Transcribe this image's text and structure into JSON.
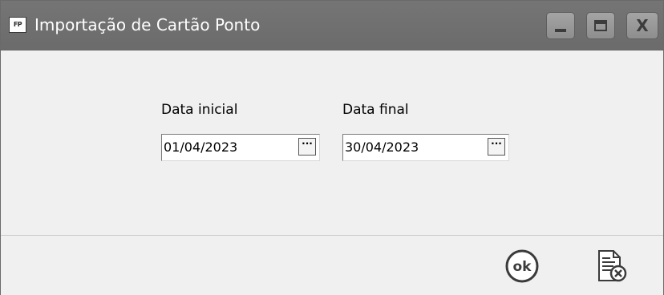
{
  "window": {
    "app_icon": "FP",
    "title": "Importação de Cartão Ponto",
    "controls": [
      "minimize-icon",
      "maximize-icon",
      "close-icon"
    ]
  },
  "form": {
    "start_date": {
      "label": "Data inicial",
      "value": "01/04/2023",
      "button": "···"
    },
    "end_date": {
      "label": "Data final",
      "value": "30/04/2023",
      "button": "···"
    }
  },
  "footer": {
    "ok_icon": "ok-icon",
    "ok_label": "ok",
    "cancel_icon": "document-cancel-icon"
  },
  "colors": {
    "titlebar": "#6f6f6f",
    "background": "#f0f0f0"
  }
}
